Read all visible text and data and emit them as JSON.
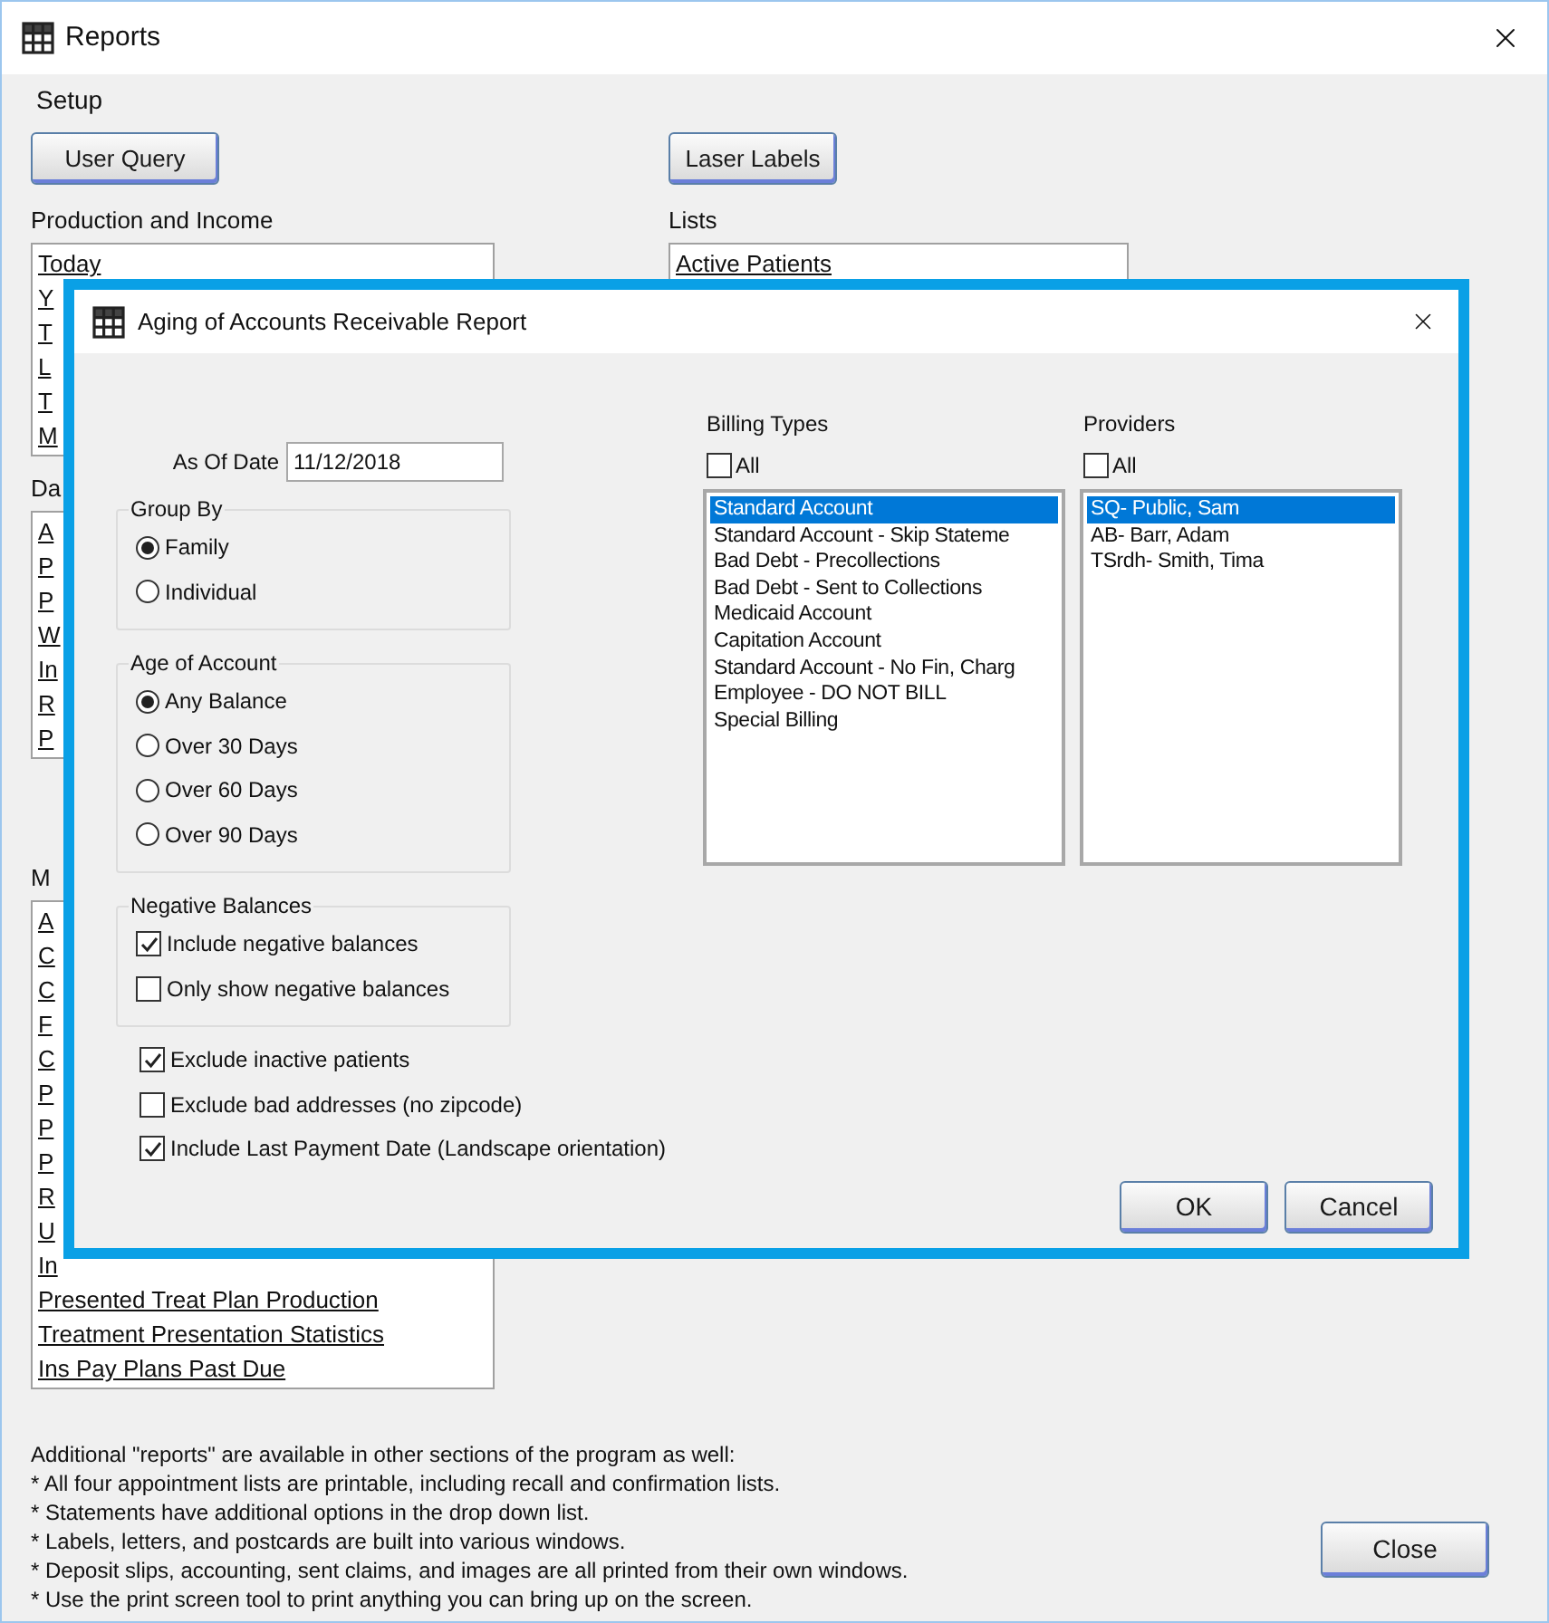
{
  "window": {
    "title": "Reports"
  },
  "menu": [
    {
      "label": "Setup"
    }
  ],
  "left_column": {
    "button": "User Query",
    "sections": [
      {
        "label": "Production and Income",
        "items": [
          "Today",
          "Y",
          "T",
          "L",
          "T",
          "M"
        ]
      },
      {
        "label": "Da",
        "items": [
          "A",
          "P",
          "P",
          "W",
          "In",
          "R",
          "P"
        ]
      },
      {
        "label": "M",
        "items": [
          "A",
          "C",
          "C",
          "F",
          "C",
          "P",
          "P",
          "P",
          "R",
          "U",
          "In",
          "Presented Treat Plan Production",
          "Treatment Presentation Statistics",
          "Ins Pay Plans Past Due"
        ]
      }
    ]
  },
  "right_column": {
    "button": "Laser Labels",
    "sections": [
      {
        "label": "Lists",
        "items": [
          "Active Patients"
        ]
      }
    ]
  },
  "notes": [
    "Additional \"reports\" are available in other sections of the program as well:",
    "* All four appointment lists are printable, including recall and confirmation lists.",
    "* Statements have additional options in the drop down list.",
    "* Labels, letters, and postcards are built into various windows.",
    "* Deposit slips, accounting, sent claims, and images are all printed from their own windows.",
    "* Use the print screen tool to print anything you can bring up on the screen."
  ],
  "close_button": "Close",
  "dialog": {
    "title": "Aging of Accounts Receivable Report",
    "as_of_date": {
      "label": "As Of Date",
      "value": "11/12/2018"
    },
    "groups": [
      {
        "label": "Group By",
        "kind": "radio",
        "options": [
          {
            "label": "Family",
            "selected": true
          },
          {
            "label": "Individual",
            "selected": false
          }
        ]
      },
      {
        "label": "Age of Account",
        "kind": "radio",
        "options": [
          {
            "label": "Any Balance",
            "selected": true
          },
          {
            "label": "Over 30 Days",
            "selected": false
          },
          {
            "label": "Over 60 Days",
            "selected": false
          },
          {
            "label": "Over 90 Days",
            "selected": false
          }
        ]
      },
      {
        "label": "Negative Balances",
        "kind": "checkbox",
        "options": [
          {
            "label": "Include negative balances",
            "checked": true
          },
          {
            "label": "Only show negative balances",
            "checked": false
          }
        ]
      }
    ],
    "checks": [
      {
        "label": "Exclude inactive patients",
        "checked": true
      },
      {
        "label": "Exclude bad addresses (no zipcode)",
        "checked": false
      },
      {
        "label": "Include Last Payment Date (Landscape orientation)",
        "checked": true
      }
    ],
    "lists": [
      {
        "label": "Billing Types",
        "all": {
          "label": "All",
          "checked": false
        },
        "items": [
          {
            "label": "Standard Account",
            "selected": true
          },
          {
            "label": "Standard Account - Skip Stateme",
            "selected": false
          },
          {
            "label": "Bad Debt - Precollections",
            "selected": false
          },
          {
            "label": "Bad Debt - Sent to Collections",
            "selected": false
          },
          {
            "label": "Medicaid Account",
            "selected": false
          },
          {
            "label": "Capitation Account",
            "selected": false
          },
          {
            "label": "Standard Account - No Fin, Charg",
            "selected": false
          },
          {
            "label": "Employee - DO NOT BILL",
            "selected": false
          },
          {
            "label": "Special Billing",
            "selected": false
          }
        ]
      },
      {
        "label": "Providers",
        "all": {
          "label": "All",
          "checked": false
        },
        "items": [
          {
            "label": "SQ- Public, Sam",
            "selected": true
          },
          {
            "label": "AB- Barr, Adam",
            "selected": false
          },
          {
            "label": "TSrdh- Smith, Tima",
            "selected": false
          }
        ]
      }
    ],
    "buttons": [
      "OK",
      "Cancel"
    ]
  }
}
